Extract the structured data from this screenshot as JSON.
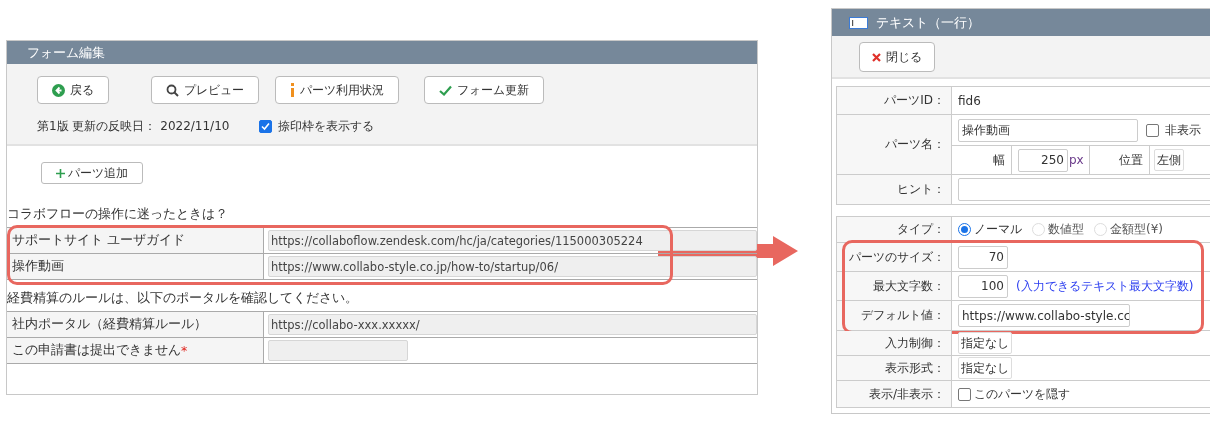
{
  "form_editor": {
    "title": "フォーム編集",
    "buttons": [
      {
        "kind": "back",
        "label": "戻る"
      },
      {
        "kind": "preview",
        "label": "プレビュー"
      },
      {
        "kind": "info",
        "label": "パーツ利用状況"
      },
      {
        "kind": "update",
        "label": "フォーム更新"
      }
    ],
    "version_info": "第1版 更新の反映日： 2022/11/10",
    "stamp_checkbox": {
      "label": "捺印枠を表示する",
      "checked": true
    },
    "add_button": "パーツ追加",
    "sections": [
      {
        "heading": "コラボフローの操作に迷ったときは？",
        "highlighted": true,
        "rows": [
          {
            "label": "サポートサイト ユーザガイド",
            "value": "https://collaboflow.zendesk.com/hc/ja/categories/115000305224",
            "wide": true
          },
          {
            "label": "操作動画",
            "value": "https://www.collabo-style.co.jp/how-to/startup/06/",
            "wide": true
          }
        ]
      },
      {
        "heading": "経費精算のルールは、以下のポータルを確認してください。",
        "highlighted": false,
        "rows": [
          {
            "label": "社内ポータル（経費精算ルール）",
            "value": "https://collabo-xxx.xxxxx/",
            "wide": true
          },
          {
            "label": "この申請書は提出できません",
            "required_mark": "*",
            "wide": false
          }
        ]
      }
    ]
  },
  "part_editor": {
    "title": "テキスト（一行）",
    "close_button": "閉じる",
    "top_rows": [
      {
        "kind": "text",
        "label": "パーツID：",
        "value": "fid6"
      },
      {
        "kind": "name",
        "label": "パーツ名：",
        "value": "操作動画",
        "hidden_checkbox": {
          "label": "非表示",
          "checked": false
        },
        "width_label": "幅",
        "width_value": "250",
        "width_unit": "px",
        "position_label": "位置",
        "position_value": "左側"
      },
      {
        "kind": "input",
        "label": "ヒント："
      }
    ],
    "rows": [
      {
        "kind": "radio",
        "label": "タイプ：",
        "highlighted": false,
        "options": [
          {
            "label": "ノーマル",
            "selected": true
          },
          {
            "label": "数値型",
            "selected": false
          },
          {
            "label": "金額型(¥)",
            "selected": false
          }
        ]
      },
      {
        "kind": "number",
        "label": "パーツのサイズ：",
        "highlighted": true,
        "value": "70"
      },
      {
        "kind": "number",
        "label": "最大文字数：",
        "highlighted": true,
        "value": "100",
        "note": "(入力できるテキスト最大文字数)"
      },
      {
        "kind": "input",
        "label": "デフォルト値：",
        "highlighted": true,
        "value": "https://www.collabo-style.cc"
      },
      {
        "kind": "select",
        "label": "入力制御：",
        "highlighted": false,
        "value": "指定なし"
      },
      {
        "kind": "select",
        "label": "表示形式：",
        "highlighted": false,
        "value": "指定なし"
      },
      {
        "kind": "checkbox",
        "label": "表示/非表示：",
        "highlighted": false,
        "checkbox_label": "このパーツを隠す",
        "checked": false
      }
    ]
  }
}
